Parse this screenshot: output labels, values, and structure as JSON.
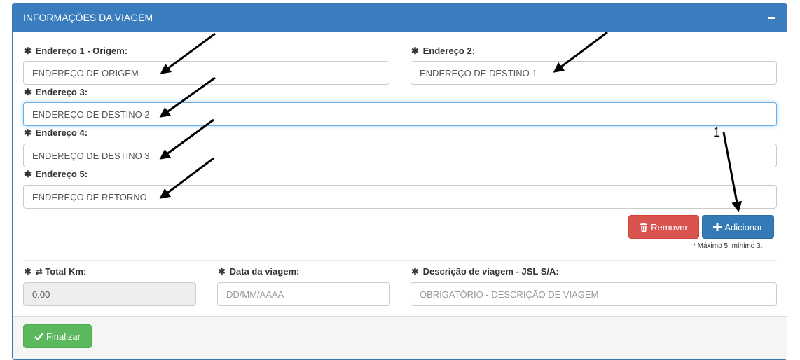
{
  "panel": {
    "title": "INFORMAÇÕES DA VIAGEM",
    "collapse_icon": "minus-icon"
  },
  "addresses": [
    {
      "label": "Endereço 1 - Origem:",
      "value": "ENDEREÇO DE ORIGEM"
    },
    {
      "label": "Endereço 2:",
      "value": "ENDEREÇO DE DESTINO 1"
    },
    {
      "label": "Endereço 3:",
      "value": "ENDEREÇO DE DESTINO 2"
    },
    {
      "label": "Endereço 4:",
      "value": "ENDEREÇO DE DESTINO 3"
    },
    {
      "label": "Endereço 5:",
      "value": "ENDEREÇO DE RETORNO"
    }
  ],
  "buttons": {
    "remove_label": "Remover",
    "add_label": "Adicionar",
    "finish_label": "Finalizar"
  },
  "hint": "* Máximo 5, mínimo 3.",
  "total_km": {
    "label": "Total Km:",
    "value": "0,00"
  },
  "trip_date": {
    "label": "Data da viagem:",
    "placeholder": "DD/MM/AAAA"
  },
  "description": {
    "label": "Descrição de viagem - JSL S/A:",
    "placeholder": "OBRIGATÓRIO - DESCRIÇÃO DE VIAGEM"
  },
  "annotation": {
    "label": "1"
  },
  "icons": {
    "required": "asterisk-icon",
    "total_km": "exchange-icon",
    "remove": "trash-icon",
    "add": "plus-icon",
    "finish": "check-icon"
  },
  "colors": {
    "heading": "#3a7dbf",
    "danger": "#d9534f",
    "primary": "#337ab7",
    "success": "#5cb85c",
    "focus": "#66afe9"
  }
}
